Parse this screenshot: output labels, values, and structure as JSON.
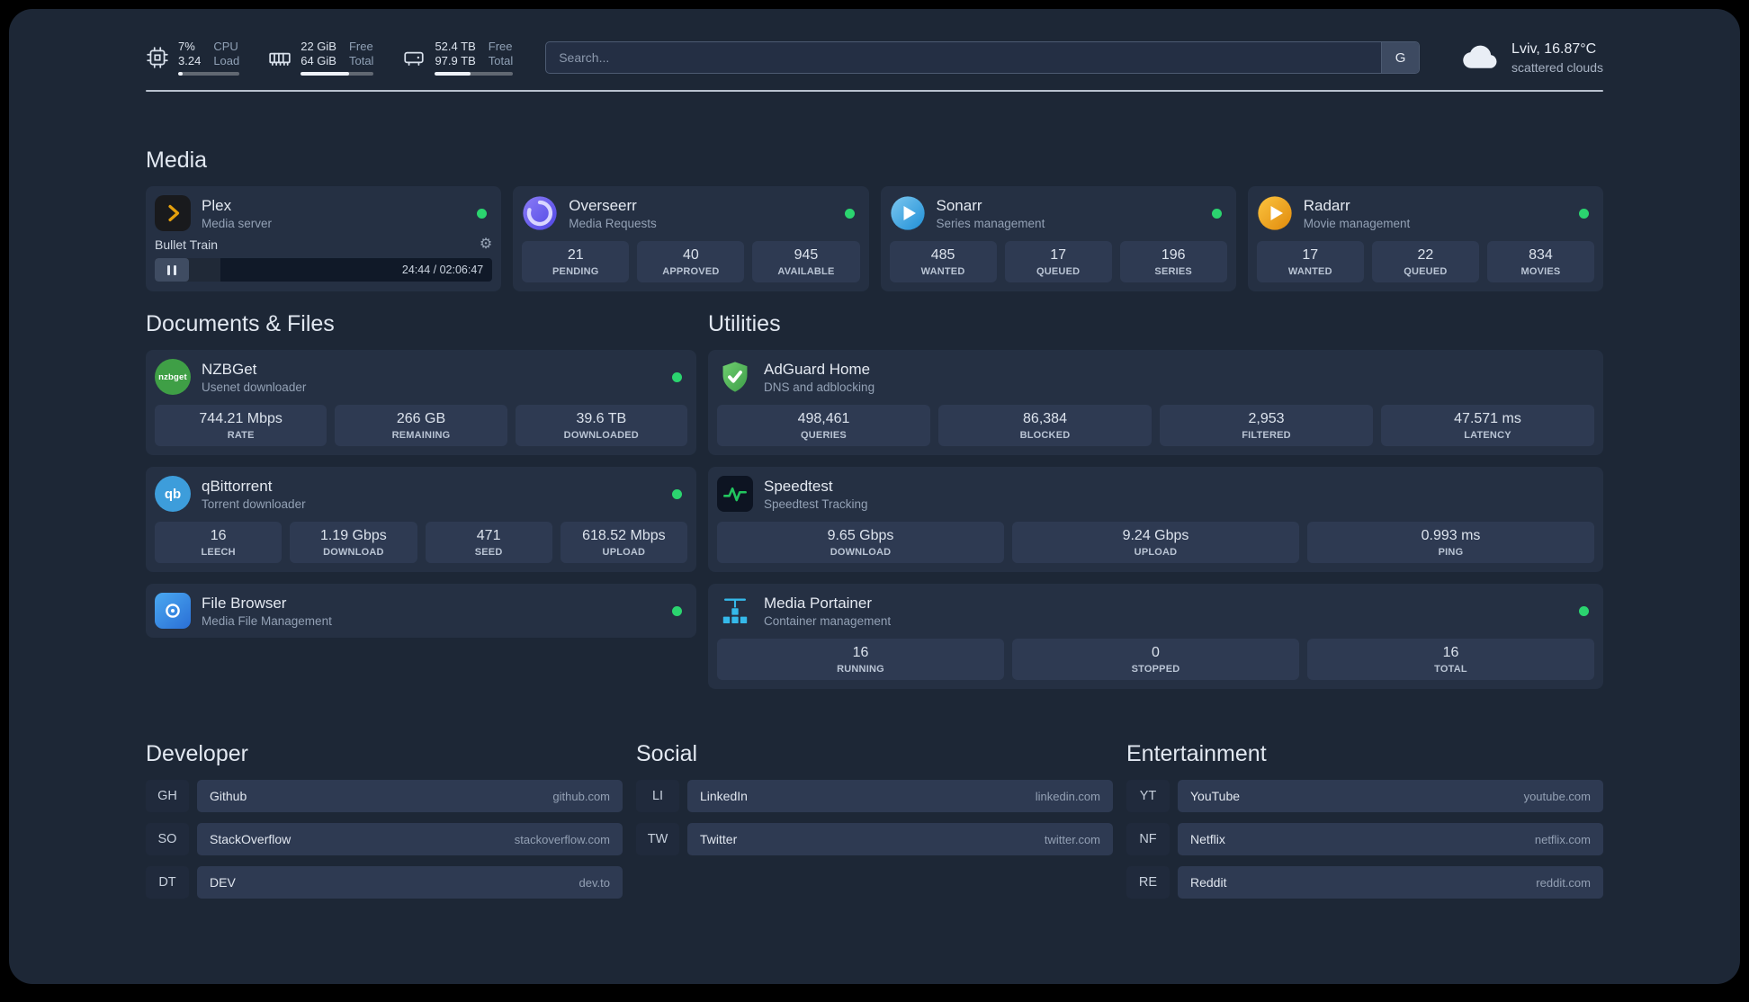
{
  "topbar": {
    "resources": [
      {
        "kind": "cpu",
        "values": [
          "7%",
          "3.24"
        ],
        "labels": [
          "CPU",
          "Load"
        ],
        "bar_percent": 7
      },
      {
        "kind": "memory",
        "values": [
          "22 GiB",
          "64 GiB"
        ],
        "labels": [
          "Free",
          "Total"
        ],
        "bar_percent": 66
      },
      {
        "kind": "disk",
        "values": [
          "52.4 TB",
          "97.9 TB"
        ],
        "labels": [
          "Free",
          "Total"
        ],
        "bar_percent": 46
      }
    ],
    "search": {
      "placeholder": "Search...",
      "button": "G"
    },
    "weather": {
      "location": "Lviv, 16.87°C",
      "condition": "scattered clouds"
    }
  },
  "icon_text": {
    "nzbget": "nzbget",
    "qbittorrent": "qb"
  },
  "sections": {
    "media": {
      "title": "Media",
      "services": [
        {
          "name": "Plex",
          "subtitle": "Media server",
          "online": true,
          "player": {
            "track": "Bullet Train",
            "time": "24:44 / 02:06:47",
            "progress_percent": 19.5
          }
        },
        {
          "name": "Overseerr",
          "subtitle": "Media Requests",
          "online": true,
          "stats": [
            {
              "value": "21",
              "label": "PENDING"
            },
            {
              "value": "40",
              "label": "APPROVED"
            },
            {
              "value": "945",
              "label": "AVAILABLE"
            }
          ]
        },
        {
          "name": "Sonarr",
          "subtitle": "Series management",
          "online": true,
          "stats": [
            {
              "value": "485",
              "label": "WANTED"
            },
            {
              "value": "17",
              "label": "QUEUED"
            },
            {
              "value": "196",
              "label": "SERIES"
            }
          ]
        },
        {
          "name": "Radarr",
          "subtitle": "Movie management",
          "online": true,
          "stats": [
            {
              "value": "17",
              "label": "WANTED"
            },
            {
              "value": "22",
              "label": "QUEUED"
            },
            {
              "value": "834",
              "label": "MOVIES"
            }
          ]
        }
      ]
    },
    "documents": {
      "title": "Documents & Files",
      "services": [
        {
          "name": "NZBGet",
          "subtitle": "Usenet downloader",
          "online": true,
          "stats": [
            {
              "value": "744.21 Mbps",
              "label": "RATE"
            },
            {
              "value": "266 GB",
              "label": "REMAINING"
            },
            {
              "value": "39.6 TB",
              "label": "DOWNLOADED"
            }
          ]
        },
        {
          "name": "qBittorrent",
          "subtitle": "Torrent downloader",
          "online": true,
          "stats": [
            {
              "value": "16",
              "label": "LEECH"
            },
            {
              "value": "1.19 Gbps",
              "label": "DOWNLOAD"
            },
            {
              "value": "471",
              "label": "SEED"
            },
            {
              "value": "618.52 Mbps",
              "label": "UPLOAD"
            }
          ]
        },
        {
          "name": "File Browser",
          "subtitle": "Media File Management",
          "online": true,
          "stats": []
        }
      ]
    },
    "utilities": {
      "title": "Utilities",
      "services": [
        {
          "name": "AdGuard Home",
          "subtitle": "DNS and adblocking",
          "online": false,
          "stats": [
            {
              "value": "498,461",
              "label": "QUERIES"
            },
            {
              "value": "86,384",
              "label": "BLOCKED"
            },
            {
              "value": "2,953",
              "label": "FILTERED"
            },
            {
              "value": "47.571 ms",
              "label": "LATENCY"
            }
          ]
        },
        {
          "name": "Speedtest",
          "subtitle": "Speedtest Tracking",
          "online": false,
          "stats": [
            {
              "value": "9.65 Gbps",
              "label": "DOWNLOAD"
            },
            {
              "value": "9.24 Gbps",
              "label": "UPLOAD"
            },
            {
              "value": "0.993 ms",
              "label": "PING"
            }
          ]
        },
        {
          "name": "Media Portainer",
          "subtitle": "Container management",
          "online": true,
          "stats": [
            {
              "value": "16",
              "label": "RUNNING"
            },
            {
              "value": "0",
              "label": "STOPPED"
            },
            {
              "value": "16",
              "label": "TOTAL"
            }
          ]
        }
      ]
    }
  },
  "bookmarks": [
    {
      "title": "Developer",
      "items": [
        {
          "abbr": "GH",
          "name": "Github",
          "url": "github.com"
        },
        {
          "abbr": "SO",
          "name": "StackOverflow",
          "url": "stackoverflow.com"
        },
        {
          "abbr": "DT",
          "name": "DEV",
          "url": "dev.to"
        }
      ]
    },
    {
      "title": "Social",
      "items": [
        {
          "abbr": "LI",
          "name": "LinkedIn",
          "url": "linkedin.com"
        },
        {
          "abbr": "TW",
          "name": "Twitter",
          "url": "twitter.com"
        }
      ]
    },
    {
      "title": "Entertainment",
      "items": [
        {
          "abbr": "YT",
          "name": "YouTube",
          "url": "youtube.com"
        },
        {
          "abbr": "NF",
          "name": "Netflix",
          "url": "netflix.com"
        },
        {
          "abbr": "RE",
          "name": "Reddit",
          "url": "reddit.com"
        }
      ]
    }
  ],
  "colors": {
    "status_online": "#2bd46f",
    "accent_plex": "#e5a00d",
    "speedtest_line": "#22c55e"
  }
}
